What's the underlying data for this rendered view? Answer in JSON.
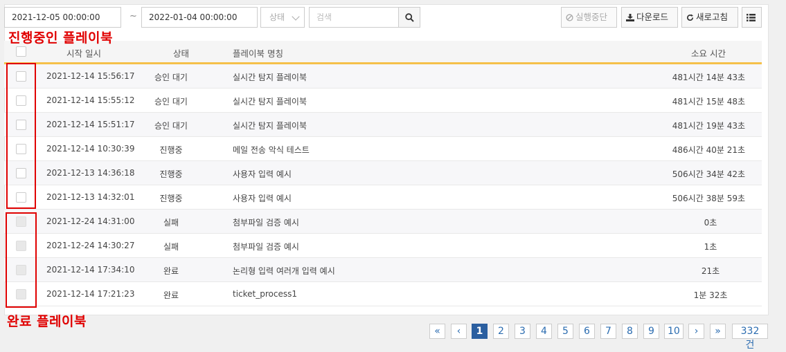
{
  "filters": {
    "start_date": "2021-12-05 00:00:00",
    "tilde": "~",
    "end_date": "2022-01-04 00:00:00",
    "status_placeholder": "상태",
    "search_placeholder": "검색"
  },
  "toolbar": {
    "stop_label": "실행중단",
    "download_label": "다운로드",
    "refresh_label": "새로고침"
  },
  "table": {
    "columns": [
      "시작 일시",
      "상태",
      "플레이북 명칭",
      "소요 시간"
    ],
    "rows": [
      {
        "date": "2021-12-14 15:56:17",
        "status": "승인 대기",
        "name": "실시간 탐지 플레이북",
        "duration": "481시간 14분 43초"
      },
      {
        "date": "2021-12-14 15:55:12",
        "status": "승인 대기",
        "name": "실시간 탐지 플레이북",
        "duration": "481시간 15분 48초"
      },
      {
        "date": "2021-12-14 15:51:17",
        "status": "승인 대기",
        "name": "실시간 탐지 플레이북",
        "duration": "481시간 19분 43초"
      },
      {
        "date": "2021-12-14 10:30:39",
        "status": "진행중",
        "name": "메일 전송 악식 테스트",
        "duration": "486시간 40분 21초"
      },
      {
        "date": "2021-12-13 14:36:18",
        "status": "진행중",
        "name": "사용자 입력 예시",
        "duration": "506시간 34분 42초"
      },
      {
        "date": "2021-12-13 14:32:01",
        "status": "진행중",
        "name": "사용자 입력 예시",
        "duration": "506시간 38분 59초"
      },
      {
        "date": "2021-12-24 14:31:00",
        "status": "실패",
        "name": "첨부파일 검증 예시",
        "duration": "0초"
      },
      {
        "date": "2021-12-24 14:30:27",
        "status": "실패",
        "name": "첨부파일 검증 예시",
        "duration": "1초"
      },
      {
        "date": "2021-12-14 17:34:10",
        "status": "완료",
        "name": "논리형 입력 여러개 입력 예시",
        "duration": "21초"
      },
      {
        "date": "2021-12-14 17:21:23",
        "status": "완료",
        "name": "ticket_process1",
        "duration": "1분 32초"
      }
    ]
  },
  "annotations": {
    "running": "진행중인 플레이북",
    "completed": "완료 플레이북",
    "color": "#e00000"
  },
  "pagination": {
    "first": "«",
    "prev": "‹",
    "pages": [
      "1",
      "2",
      "3",
      "4",
      "5",
      "6",
      "7",
      "8",
      "9",
      "10"
    ],
    "next": "›",
    "last": "»",
    "total": "332 건",
    "active": "1"
  },
  "colors": {
    "header_accent": "#f5c04a",
    "active_page": "#2b5fa0"
  }
}
